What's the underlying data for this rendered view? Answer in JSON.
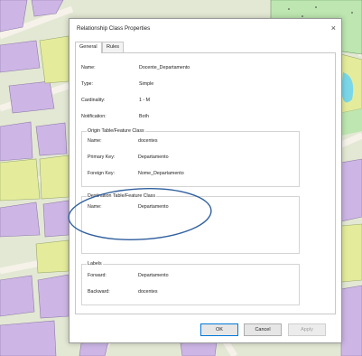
{
  "dialog": {
    "title": "Relationship Class Properties",
    "close_glyph": "×"
  },
  "tabs": [
    {
      "label": "General",
      "active": true
    },
    {
      "label": "Rules",
      "active": false
    }
  ],
  "general": {
    "fields": [
      {
        "label": "Name:",
        "value": "Docente_Departamento"
      },
      {
        "label": "Type:",
        "value": "Simple"
      },
      {
        "label": "Cardinality:",
        "value": "1 - M"
      },
      {
        "label": "Notification:",
        "value": "Both"
      }
    ]
  },
  "origin": {
    "title": "Origin Table/Feature Class",
    "fields": [
      {
        "label": "Name:",
        "value": "docentes"
      },
      {
        "label": "Primary Key:",
        "value": "Departamento"
      },
      {
        "label": "Foreign Key:",
        "value": "Nome_Departamento"
      }
    ]
  },
  "destination": {
    "title": "Destination Table/Feature Class",
    "fields": [
      {
        "label": "Name:",
        "value": "Departamento"
      }
    ]
  },
  "labels": {
    "title": "Labels",
    "fields": [
      {
        "label": "Forward:",
        "value": "Departamento"
      },
      {
        "label": "Backward:",
        "value": "docentes"
      }
    ]
  },
  "buttons": {
    "ok": "OK",
    "cancel": "Cancel",
    "apply": "Apply"
  },
  "colors": {
    "annotation_ellipse": "#2f5f9e",
    "ok_border": "#0078d7"
  }
}
